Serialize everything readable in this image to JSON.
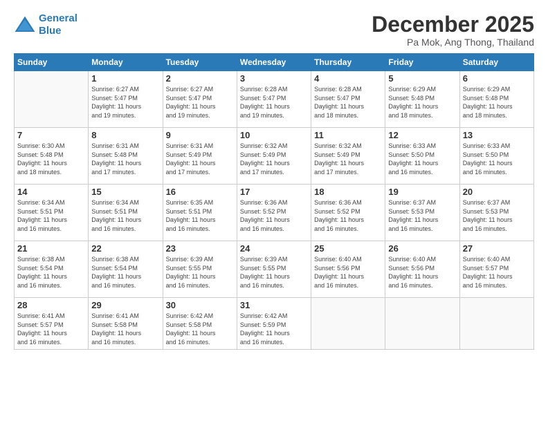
{
  "logo": {
    "line1": "General",
    "line2": "Blue"
  },
  "title": "December 2025",
  "location": "Pa Mok, Ang Thong, Thailand",
  "days_of_week": [
    "Sunday",
    "Monday",
    "Tuesday",
    "Wednesday",
    "Thursday",
    "Friday",
    "Saturday"
  ],
  "weeks": [
    [
      {
        "day": "",
        "info": ""
      },
      {
        "day": "1",
        "info": "Sunrise: 6:27 AM\nSunset: 5:47 PM\nDaylight: 11 hours\nand 19 minutes."
      },
      {
        "day": "2",
        "info": "Sunrise: 6:27 AM\nSunset: 5:47 PM\nDaylight: 11 hours\nand 19 minutes."
      },
      {
        "day": "3",
        "info": "Sunrise: 6:28 AM\nSunset: 5:47 PM\nDaylight: 11 hours\nand 19 minutes."
      },
      {
        "day": "4",
        "info": "Sunrise: 6:28 AM\nSunset: 5:47 PM\nDaylight: 11 hours\nand 18 minutes."
      },
      {
        "day": "5",
        "info": "Sunrise: 6:29 AM\nSunset: 5:48 PM\nDaylight: 11 hours\nand 18 minutes."
      },
      {
        "day": "6",
        "info": "Sunrise: 6:29 AM\nSunset: 5:48 PM\nDaylight: 11 hours\nand 18 minutes."
      }
    ],
    [
      {
        "day": "7",
        "info": "Sunrise: 6:30 AM\nSunset: 5:48 PM\nDaylight: 11 hours\nand 18 minutes."
      },
      {
        "day": "8",
        "info": "Sunrise: 6:31 AM\nSunset: 5:48 PM\nDaylight: 11 hours\nand 17 minutes."
      },
      {
        "day": "9",
        "info": "Sunrise: 6:31 AM\nSunset: 5:49 PM\nDaylight: 11 hours\nand 17 minutes."
      },
      {
        "day": "10",
        "info": "Sunrise: 6:32 AM\nSunset: 5:49 PM\nDaylight: 11 hours\nand 17 minutes."
      },
      {
        "day": "11",
        "info": "Sunrise: 6:32 AM\nSunset: 5:49 PM\nDaylight: 11 hours\nand 17 minutes."
      },
      {
        "day": "12",
        "info": "Sunrise: 6:33 AM\nSunset: 5:50 PM\nDaylight: 11 hours\nand 16 minutes."
      },
      {
        "day": "13",
        "info": "Sunrise: 6:33 AM\nSunset: 5:50 PM\nDaylight: 11 hours\nand 16 minutes."
      }
    ],
    [
      {
        "day": "14",
        "info": "Sunrise: 6:34 AM\nSunset: 5:51 PM\nDaylight: 11 hours\nand 16 minutes."
      },
      {
        "day": "15",
        "info": "Sunrise: 6:34 AM\nSunset: 5:51 PM\nDaylight: 11 hours\nand 16 minutes."
      },
      {
        "day": "16",
        "info": "Sunrise: 6:35 AM\nSunset: 5:51 PM\nDaylight: 11 hours\nand 16 minutes."
      },
      {
        "day": "17",
        "info": "Sunrise: 6:36 AM\nSunset: 5:52 PM\nDaylight: 11 hours\nand 16 minutes."
      },
      {
        "day": "18",
        "info": "Sunrise: 6:36 AM\nSunset: 5:52 PM\nDaylight: 11 hours\nand 16 minutes."
      },
      {
        "day": "19",
        "info": "Sunrise: 6:37 AM\nSunset: 5:53 PM\nDaylight: 11 hours\nand 16 minutes."
      },
      {
        "day": "20",
        "info": "Sunrise: 6:37 AM\nSunset: 5:53 PM\nDaylight: 11 hours\nand 16 minutes."
      }
    ],
    [
      {
        "day": "21",
        "info": "Sunrise: 6:38 AM\nSunset: 5:54 PM\nDaylight: 11 hours\nand 16 minutes."
      },
      {
        "day": "22",
        "info": "Sunrise: 6:38 AM\nSunset: 5:54 PM\nDaylight: 11 hours\nand 16 minutes."
      },
      {
        "day": "23",
        "info": "Sunrise: 6:39 AM\nSunset: 5:55 PM\nDaylight: 11 hours\nand 16 minutes."
      },
      {
        "day": "24",
        "info": "Sunrise: 6:39 AM\nSunset: 5:55 PM\nDaylight: 11 hours\nand 16 minutes."
      },
      {
        "day": "25",
        "info": "Sunrise: 6:40 AM\nSunset: 5:56 PM\nDaylight: 11 hours\nand 16 minutes."
      },
      {
        "day": "26",
        "info": "Sunrise: 6:40 AM\nSunset: 5:56 PM\nDaylight: 11 hours\nand 16 minutes."
      },
      {
        "day": "27",
        "info": "Sunrise: 6:40 AM\nSunset: 5:57 PM\nDaylight: 11 hours\nand 16 minutes."
      }
    ],
    [
      {
        "day": "28",
        "info": "Sunrise: 6:41 AM\nSunset: 5:57 PM\nDaylight: 11 hours\nand 16 minutes."
      },
      {
        "day": "29",
        "info": "Sunrise: 6:41 AM\nSunset: 5:58 PM\nDaylight: 11 hours\nand 16 minutes."
      },
      {
        "day": "30",
        "info": "Sunrise: 6:42 AM\nSunset: 5:58 PM\nDaylight: 11 hours\nand 16 minutes."
      },
      {
        "day": "31",
        "info": "Sunrise: 6:42 AM\nSunset: 5:59 PM\nDaylight: 11 hours\nand 16 minutes."
      },
      {
        "day": "",
        "info": ""
      },
      {
        "day": "",
        "info": ""
      },
      {
        "day": "",
        "info": ""
      }
    ]
  ]
}
